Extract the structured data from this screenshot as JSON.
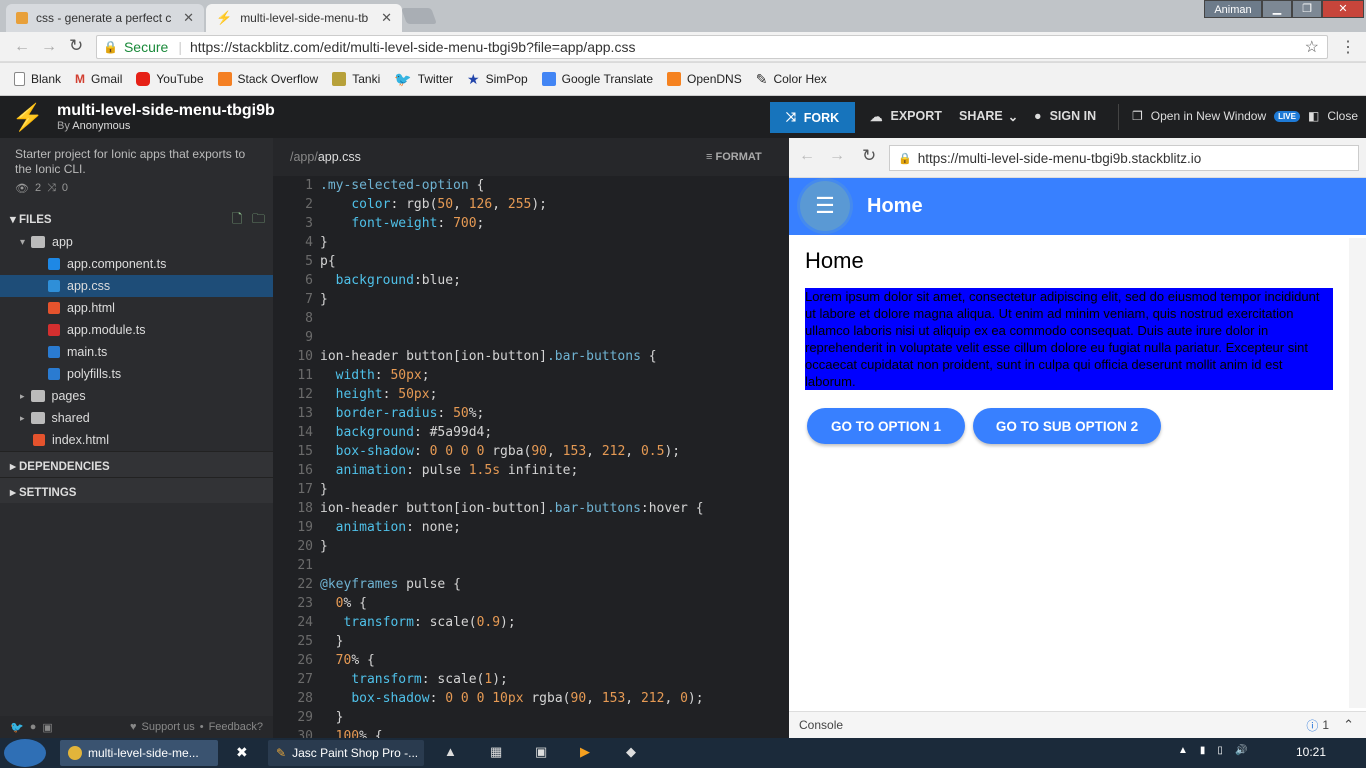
{
  "browser": {
    "tabs": [
      {
        "label": "css - generate a perfect c"
      },
      {
        "label": "multi-level-side-menu-tb"
      }
    ],
    "window_user": "Animan",
    "secure_label": "Secure",
    "url": "https://stackblitz.com/edit/multi-level-side-menu-tbgi9b?file=app/app.css",
    "bookmarks": [
      {
        "label": "Blank"
      },
      {
        "label": "Gmail"
      },
      {
        "label": "YouTube"
      },
      {
        "label": "Stack Overflow"
      },
      {
        "label": "Tanki"
      },
      {
        "label": "Twitter"
      },
      {
        "label": "SimPop"
      },
      {
        "label": "Google Translate"
      },
      {
        "label": "OpenDNS"
      },
      {
        "label": "Color Hex"
      }
    ]
  },
  "stackblitz": {
    "project_title": "multi-level-side-menu-tbgi9b",
    "by_label": "By",
    "author": "Anonymous",
    "fork_label": "FORK",
    "export_label": "EXPORT",
    "share_label": "SHARE",
    "signin_label": "SIGN IN",
    "open_new_window_label": "Open in New Window",
    "live_badge": "LIVE",
    "close_label": "Close",
    "description": "Starter project for Ionic apps that exports to the Ionic CLI.",
    "views": "2",
    "forks": "0",
    "files_label": "FILES",
    "tree": [
      {
        "label": "app",
        "type": "folder"
      },
      {
        "label": "app.component.ts",
        "type": "angular-ts"
      },
      {
        "label": "app.css",
        "type": "css"
      },
      {
        "label": "app.html",
        "type": "html"
      },
      {
        "label": "app.module.ts",
        "type": "angular"
      },
      {
        "label": "main.ts",
        "type": "ts"
      },
      {
        "label": "polyfills.ts",
        "type": "ts"
      },
      {
        "label": "pages",
        "type": "folder"
      },
      {
        "label": "shared",
        "type": "folder"
      },
      {
        "label": "index.html",
        "type": "html"
      }
    ],
    "dependencies_label": "DEPENDENCIES",
    "settings_label": "SETTINGS",
    "support_label": "Support us",
    "feedback_label": "Feedback?",
    "editor_path": "/app/",
    "editor_file": "app.css",
    "format_label": "FORMAT",
    "code_lines": [
      ".my-selected-option {",
      "    color: rgb(50, 126, 255);",
      "    font-weight: 700;",
      "}",
      "p{",
      "  background:blue;",
      "}",
      "",
      "",
      "ion-header button[ion-button].bar-buttons {",
      "  width: 50px;",
      "  height: 50px;",
      "  border-radius: 50%;",
      "  background: #5a99d4;",
      "  box-shadow: 0 0 0 0 rgba(90, 153, 212, 0.5);",
      "  animation: pulse 1.5s infinite;",
      "}",
      "ion-header button[ion-button].bar-buttons:hover {",
      "  animation: none;",
      "}",
      "",
      "@keyframes pulse {",
      "  0% {",
      "   transform: scale(0.9);",
      "  }",
      "  70% {",
      "    transform: scale(1);",
      "    box-shadow: 0 0 0 10px rgba(90, 153, 212, 0);",
      "  }",
      "  100% {"
    ],
    "line_numbers": [
      "1",
      "2",
      "3",
      "4",
      "5",
      "6",
      "7",
      "8",
      "9",
      "10",
      "11",
      "12",
      "13",
      "14",
      "15",
      "16",
      "17",
      "18",
      "19",
      "20",
      "21",
      "22",
      "23",
      "24",
      "25",
      "26",
      "27",
      "28",
      "29",
      "30"
    ]
  },
  "preview": {
    "url": "https://multi-level-side-menu-tbgi9b.stackblitz.io",
    "header_title": "Home",
    "page_title": "Home",
    "paragraph": "Lorem ipsum dolor sit amet, consectetur adipiscing elit, sed do eiusmod tempor incididunt ut labore et dolore magna aliqua. Ut enim ad minim veniam, quis nostrud exercitation ullamco laboris nisi ut aliquip ex ea commodo consequat. Duis aute irure dolor in reprehenderit in voluptate velit esse cillum dolore eu fugiat nulla pariatur. Excepteur sint occaecat cupidatat non proident, sunt in culpa qui officia deserunt mollit anim id est laborum.",
    "button1": "GO TO OPTION 1",
    "button2": "GO TO SUB OPTION 2",
    "console_label": "Console",
    "console_count": "1",
    "accent": "#3880ff"
  },
  "taskbar": {
    "items": [
      {
        "label": "multi-level-side-me..."
      },
      {
        "label": "Jasc Paint Shop Pro -..."
      }
    ],
    "clock": "10:21"
  }
}
